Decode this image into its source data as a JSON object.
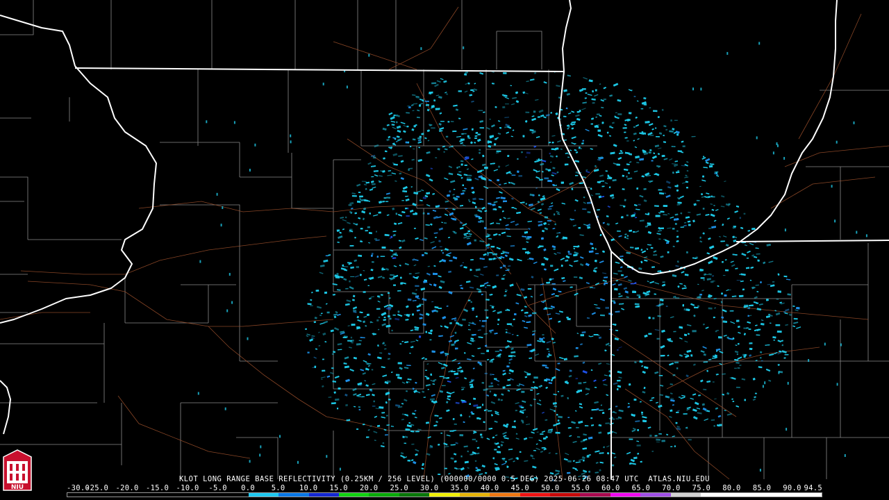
{
  "product_label": "KLOT LONG RANGE BASE REFLECTIVITY (0.25KM / 256 LEVEL) (000000/0000 0.5 DEG) 2025-06-26 08:47 UTC  ATLAS.NIU.EDU",
  "scale": {
    "ticks": [
      "-30.0",
      "-25.0",
      "-20.0",
      "-15.0",
      "-10.0",
      "-5.0",
      "0.0",
      "5.0",
      "10.0",
      "15.0",
      "20.0",
      "25.0",
      "30.0",
      "35.0",
      "40.0",
      "45.0",
      "50.0",
      "55.0",
      "60.0",
      "65.0",
      "70.0",
      "75.0",
      "80.0",
      "85.0",
      "90.0",
      "94.5"
    ],
    "colors": [
      "#000000",
      "#000000",
      "#000000",
      "#000000",
      "#000000",
      "#000000",
      "#1fc8f0",
      "#0a78e6",
      "#1428d2",
      "#12d212",
      "#0aaa0a",
      "#0a780a",
      "#f0f00a",
      "#e6b40a",
      "#f07814",
      "#f01414",
      "#c80a0a",
      "#aa0a50",
      "#f00af0",
      "#a050e6",
      "#d2d2d2",
      "#ffffff",
      "#ffffff",
      "#ffffff",
      "#ffffff"
    ]
  },
  "colors": {
    "background": "#000000",
    "state_border": "#ffffff",
    "county_line": "#8a8a8a",
    "highway": "#a0522d",
    "echo_light": "#1ec8e6",
    "echo_medium": "#1e90e6",
    "echo_strong": "#1e50e6"
  },
  "logo": {
    "text": "NIU",
    "color": "#c8102e"
  }
}
